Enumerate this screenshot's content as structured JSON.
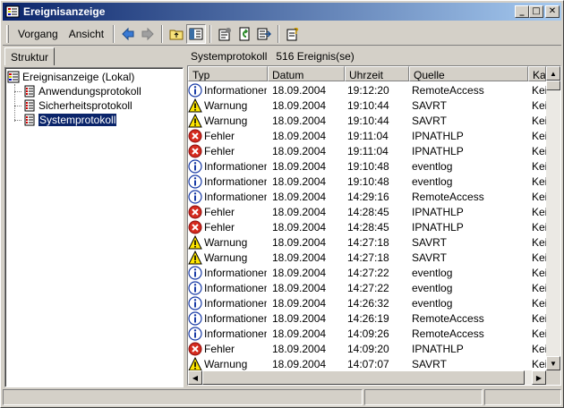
{
  "window": {
    "title": "Ereignisanzeige",
    "minimize": "_",
    "maximize": "□",
    "close": "✕"
  },
  "menu": {
    "vorgang": "Vorgang",
    "ansicht": "Ansicht"
  },
  "left": {
    "tab": "Struktur",
    "tree": [
      {
        "label": "Ereignisanzeige (Lokal)",
        "icon": "event-viewer-icon"
      },
      {
        "label": "Anwendungsprotokoll",
        "icon": "log-icon"
      },
      {
        "label": "Sicherheitsprotokoll",
        "icon": "log-icon"
      },
      {
        "label": "Systemprotokoll",
        "icon": "log-icon",
        "selected": true
      }
    ]
  },
  "right": {
    "name": "Systemprotokoll",
    "count": "516 Ereignis(se)",
    "columns": [
      "Typ",
      "Datum",
      "Uhrzeit",
      "Quelle",
      "Kat"
    ],
    "rows": [
      {
        "typ": "Informationen",
        "kind": "info",
        "datum": "18.09.2004",
        "uhrzeit": "19:12:20",
        "quelle": "RemoteAccess",
        "kat": "Kei"
      },
      {
        "typ": "Warnung",
        "kind": "warn",
        "datum": "18.09.2004",
        "uhrzeit": "19:10:44",
        "quelle": "SAVRT",
        "kat": "Kei"
      },
      {
        "typ": "Warnung",
        "kind": "warn",
        "datum": "18.09.2004",
        "uhrzeit": "19:10:44",
        "quelle": "SAVRT",
        "kat": "Kei"
      },
      {
        "typ": "Fehler",
        "kind": "error",
        "datum": "18.09.2004",
        "uhrzeit": "19:11:04",
        "quelle": "IPNATHLP",
        "kat": "Kei"
      },
      {
        "typ": "Fehler",
        "kind": "error",
        "datum": "18.09.2004",
        "uhrzeit": "19:11:04",
        "quelle": "IPNATHLP",
        "kat": "Kei"
      },
      {
        "typ": "Informationen",
        "kind": "info",
        "datum": "18.09.2004",
        "uhrzeit": "19:10:48",
        "quelle": "eventlog",
        "kat": "Kei"
      },
      {
        "typ": "Informationen",
        "kind": "info",
        "datum": "18.09.2004",
        "uhrzeit": "19:10:48",
        "quelle": "eventlog",
        "kat": "Kei"
      },
      {
        "typ": "Informationen",
        "kind": "info",
        "datum": "18.09.2004",
        "uhrzeit": "14:29:16",
        "quelle": "RemoteAccess",
        "kat": "Kei"
      },
      {
        "typ": "Fehler",
        "kind": "error",
        "datum": "18.09.2004",
        "uhrzeit": "14:28:45",
        "quelle": "IPNATHLP",
        "kat": "Kei"
      },
      {
        "typ": "Fehler",
        "kind": "error",
        "datum": "18.09.2004",
        "uhrzeit": "14:28:45",
        "quelle": "IPNATHLP",
        "kat": "Kei"
      },
      {
        "typ": "Warnung",
        "kind": "warn",
        "datum": "18.09.2004",
        "uhrzeit": "14:27:18",
        "quelle": "SAVRT",
        "kat": "Kei"
      },
      {
        "typ": "Warnung",
        "kind": "warn",
        "datum": "18.09.2004",
        "uhrzeit": "14:27:18",
        "quelle": "SAVRT",
        "kat": "Kei"
      },
      {
        "typ": "Informationen",
        "kind": "info",
        "datum": "18.09.2004",
        "uhrzeit": "14:27:22",
        "quelle": "eventlog",
        "kat": "Kei"
      },
      {
        "typ": "Informationen",
        "kind": "info",
        "datum": "18.09.2004",
        "uhrzeit": "14:27:22",
        "quelle": "eventlog",
        "kat": "Kei"
      },
      {
        "typ": "Informationen",
        "kind": "info",
        "datum": "18.09.2004",
        "uhrzeit": "14:26:32",
        "quelle": "eventlog",
        "kat": "Kei"
      },
      {
        "typ": "Informationen",
        "kind": "info",
        "datum": "18.09.2004",
        "uhrzeit": "14:26:19",
        "quelle": "RemoteAccess",
        "kat": "Kei"
      },
      {
        "typ": "Informationen",
        "kind": "info",
        "datum": "18.09.2004",
        "uhrzeit": "14:09:26",
        "quelle": "RemoteAccess",
        "kat": "Kei"
      },
      {
        "typ": "Fehler",
        "kind": "error",
        "datum": "18.09.2004",
        "uhrzeit": "14:09:20",
        "quelle": "IPNATHLP",
        "kat": "Kei"
      },
      {
        "typ": "Warnung",
        "kind": "warn",
        "datum": "18.09.2004",
        "uhrzeit": "14:07:07",
        "quelle": "SAVRT",
        "kat": "Kei"
      }
    ]
  },
  "toolbar_icons": [
    "back-arrow-icon",
    "forward-arrow-icon",
    "up-folder-icon",
    "show-hide-tree-icon",
    "properties-icon",
    "refresh-icon",
    "export-list-icon",
    "help-icon"
  ],
  "colors": {
    "title_start": "#0a246a",
    "title_end": "#a6caf0",
    "selection": "#0a246a",
    "error": "#d42a1e",
    "warn": "#ffe600",
    "info": "#1a3ca6"
  }
}
